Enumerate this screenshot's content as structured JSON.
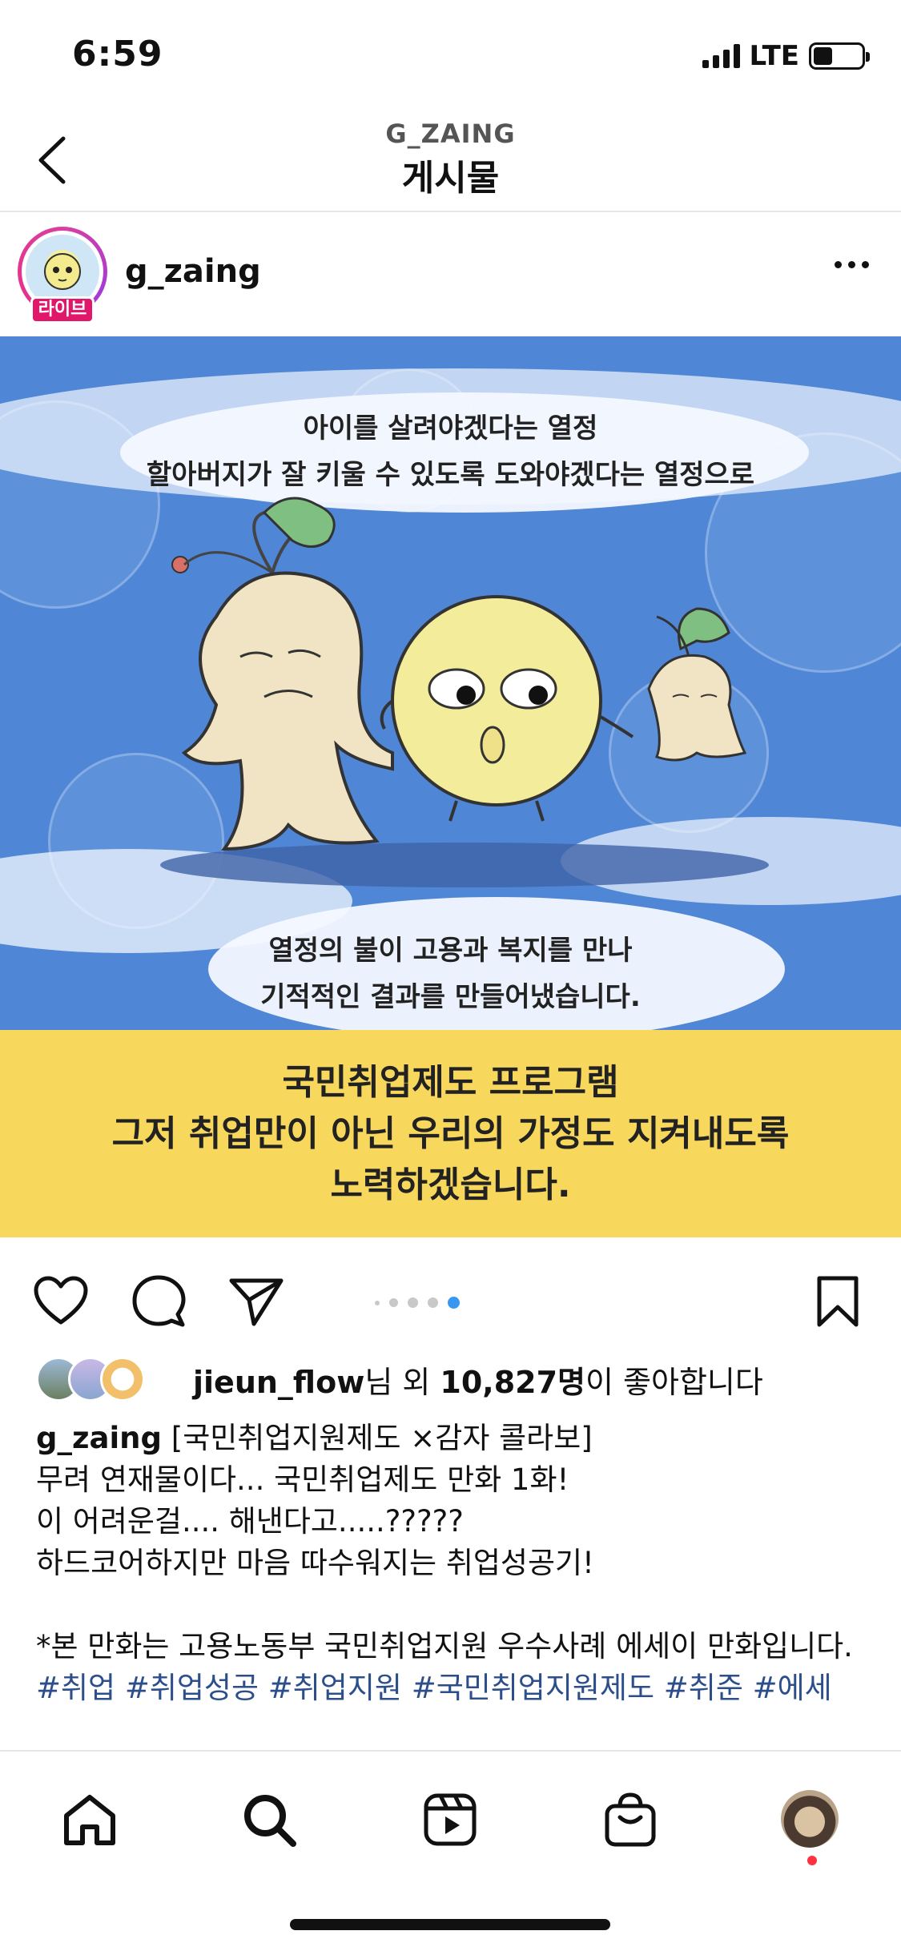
{
  "status_bar": {
    "time": "6:59",
    "network": "LTE",
    "battery_level": 0.4
  },
  "nav": {
    "subtitle": "G_ZAING",
    "title": "게시물"
  },
  "post": {
    "username": "g_zaing",
    "live_badge": "라이브",
    "image": {
      "top_caption_line1": "아이를 살려야겠다는 열정",
      "top_caption_line2": "할아버지가 잘 키울 수 있도록 도와야겠다는 열정으로",
      "bottom_caption_line1": "열정의 불이 고용과 복지를 만나",
      "bottom_caption_line2": "기적적인 결과를 만들어냈습니다.",
      "banner_line1": "국민취업제도 프로그램",
      "banner_line2": "그저 취업만이 아닌 우리의 가정도 지켜내도록",
      "banner_line3": "노력하겠습니다."
    },
    "carousel": {
      "count": 5,
      "active_index": 4
    },
    "likes": {
      "liker": "jieun_flow",
      "middle": "님 외 ",
      "count": "10,827명",
      "suffix": "이 좋아합니다"
    },
    "caption": {
      "username": "g_zaing",
      "first_line": " [국민취업지원제도 ×감자 콜라보]",
      "line2": "무려 연재물이다... 국민취업제도 만화 1화!",
      "line3": "이 어려운걸.... 해낸다고.....?????",
      "line4": "하드코어하지만 마음 따수워지는 취업성공기!",
      "line5": "*본 만화는 고용노동부 국민취업지원 우수사례 에세이 만화입니다.",
      "hashtags": "#취업 #취업성공 #취업지원 #국민취업지원제도 #취준 #에세"
    }
  },
  "colors": {
    "sky_blue": "#4f86d6",
    "banner_yellow": "#f7d75c",
    "carousel_active": "#3897f0",
    "hashtag": "#2c4f8c",
    "live_badge": "#e0176b"
  },
  "icons": {
    "back": "chevron-left-icon",
    "more": "more-horizontal-icon",
    "like": "heart-icon",
    "comment": "comment-icon",
    "share": "send-icon",
    "save": "bookmark-icon",
    "home": "home-icon",
    "search": "search-icon",
    "reels": "reels-icon",
    "shop": "shop-bag-icon"
  }
}
